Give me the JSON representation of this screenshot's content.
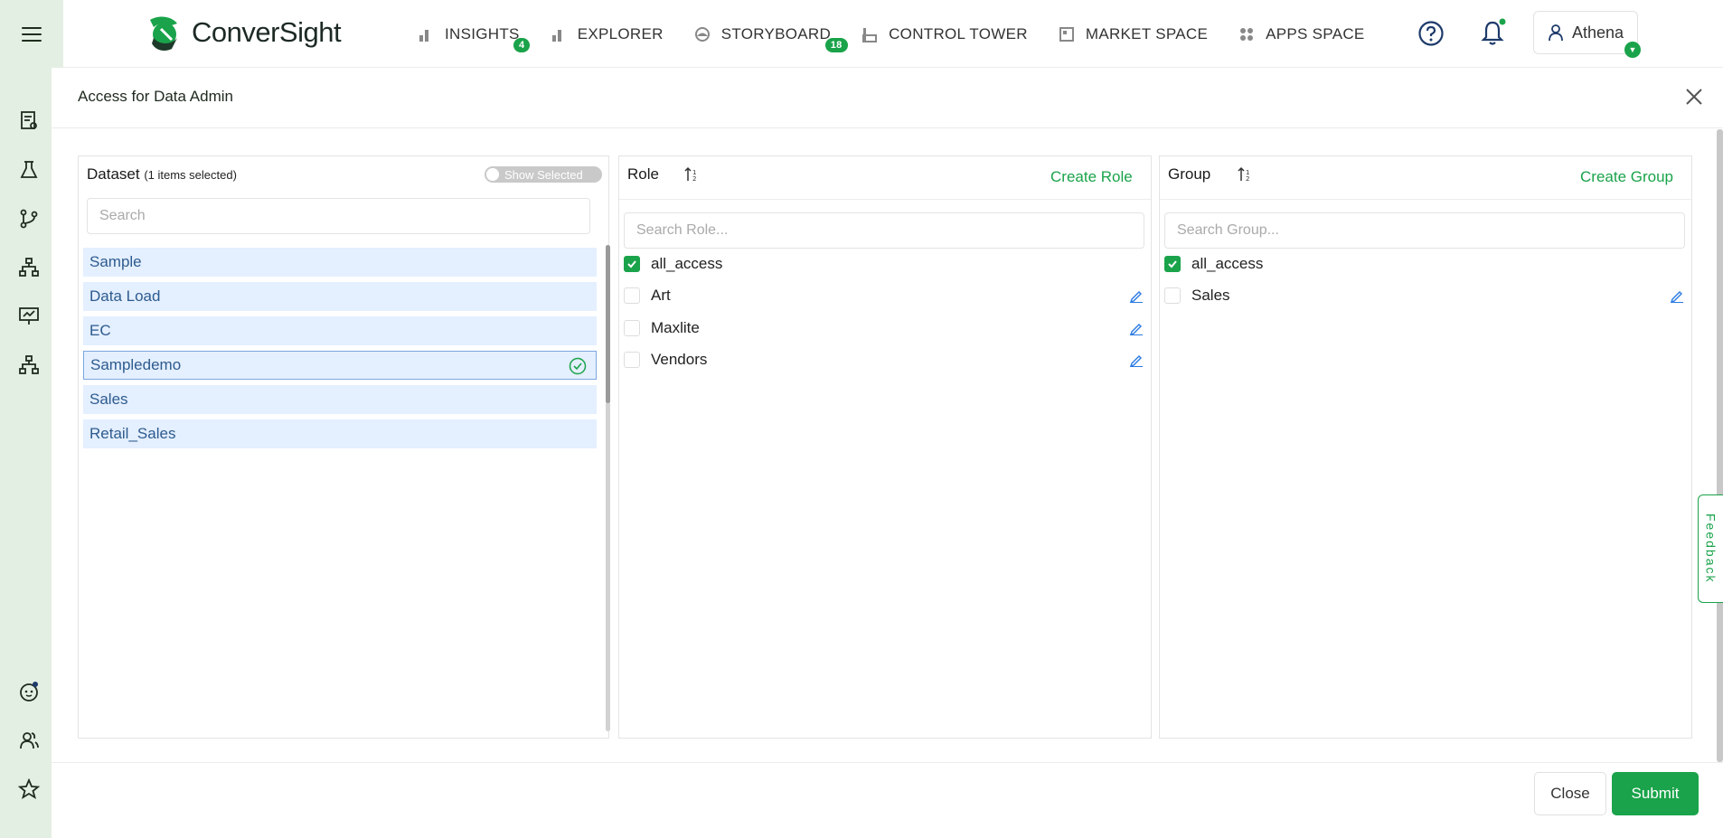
{
  "app": {
    "logo_text": "ConverSight",
    "brand_color": "#1aa34a"
  },
  "nav": {
    "items": [
      {
        "label": "INSIGHTS",
        "icon": "bar-chart-icon",
        "badge": "4"
      },
      {
        "label": "EXPLORER",
        "icon": "bar-chart-icon",
        "badge": ""
      },
      {
        "label": "STORYBOARD",
        "icon": "palette-icon",
        "badge": "18"
      },
      {
        "label": "CONTROL TOWER",
        "icon": "factory-icon",
        "badge": ""
      },
      {
        "label": "MARKET SPACE",
        "icon": "store-icon",
        "badge": ""
      },
      {
        "label": "APPS SPACE",
        "icon": "grid-icon",
        "badge": ""
      }
    ]
  },
  "user": {
    "name": "Athena"
  },
  "sidebar": {
    "icons": [
      "report-icon",
      "flask-icon",
      "branch-icon",
      "hierarchy-icon",
      "presentation-icon",
      "org-chart-icon",
      "bot-icon",
      "users-icon",
      "star-icon"
    ]
  },
  "modal": {
    "title": "Access for Data Admin",
    "dataset": {
      "title": "Dataset",
      "selected_count": "(1 items selected)",
      "toggle_label": "Show Selected",
      "search_placeholder": "Search",
      "items": [
        {
          "label": "Sample",
          "selected": false
        },
        {
          "label": "Data Load",
          "selected": false
        },
        {
          "label": "EC",
          "selected": false
        },
        {
          "label": "Sampledemo",
          "selected": true
        },
        {
          "label": "Sales",
          "selected": false
        },
        {
          "label": "Retail_Sales",
          "selected": false
        }
      ]
    },
    "role": {
      "title": "Role",
      "create_label": "Create Role",
      "search_placeholder": "Search Role...",
      "options": [
        {
          "label": "all_access",
          "checked": true,
          "editable": false
        },
        {
          "label": "Art",
          "checked": false,
          "editable": true
        },
        {
          "label": "Maxlite",
          "checked": false,
          "editable": true
        },
        {
          "label": "Vendors",
          "checked": false,
          "editable": true
        }
      ]
    },
    "group": {
      "title": "Group",
      "create_label": "Create Group",
      "search_placeholder": "Search Group...",
      "options": [
        {
          "label": "all_access",
          "checked": true,
          "editable": false
        },
        {
          "label": "Sales",
          "checked": false,
          "editable": true
        }
      ]
    },
    "close_label": "Close",
    "submit_label": "Submit"
  },
  "feedback_label": "Feedback"
}
